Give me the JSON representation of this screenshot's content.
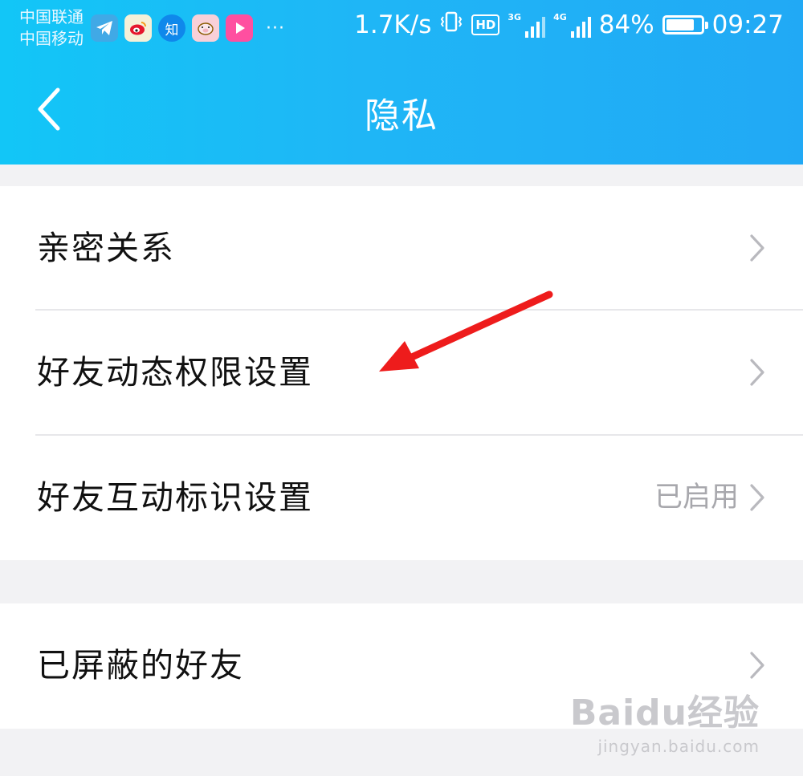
{
  "status_bar": {
    "carrier_1": "中国联通",
    "carrier_2": "中国移动",
    "notification_icons": [
      "telegram-icon",
      "weibo-icon",
      "zhihu-icon",
      "pig-app-icon",
      "youku-icon"
    ],
    "zhihu_glyph": "知",
    "more": "···",
    "speed": "1.7K/s",
    "hd": "HD",
    "net_3g": "3G",
    "net_4g": "4G",
    "battery_text": "84%",
    "battery_level": 0.84,
    "time": "09:27"
  },
  "header": {
    "title": "隐私"
  },
  "privacy_list": {
    "items": [
      {
        "label": "亲密关系",
        "value": ""
      },
      {
        "label": "好友动态权限设置",
        "value": ""
      },
      {
        "label": "好友互动标识设置",
        "value": "已启用"
      }
    ]
  },
  "blocked_list": {
    "items": [
      {
        "label": "已屏蔽的好友",
        "value": ""
      }
    ]
  },
  "watermark": {
    "logo": "Baidu经验",
    "url": "jingyan.baidu.com"
  },
  "colors": {
    "header_start": "#12c6f7",
    "header_end": "#21a9f5",
    "annotation_arrow": "#ee1c1c",
    "background": "#f2f2f4"
  }
}
